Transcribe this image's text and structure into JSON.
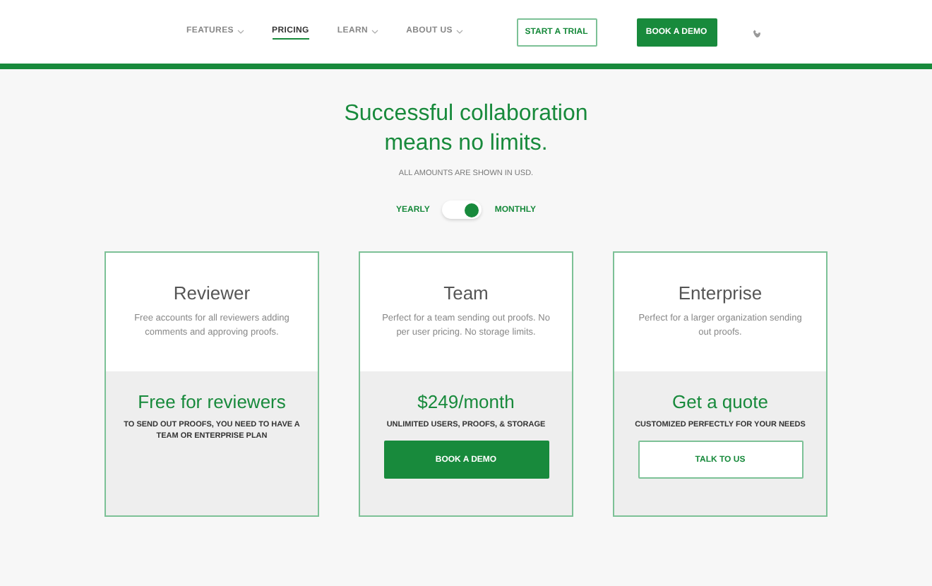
{
  "nav": {
    "items": [
      {
        "label": "FEATURES",
        "selected": false,
        "has_menu": true
      },
      {
        "label": "PRICING",
        "selected": true,
        "has_menu": false
      },
      {
        "label": "LEARN",
        "selected": false,
        "has_menu": true
      },
      {
        "label": "ABOUT US",
        "selected": false,
        "has_menu": true
      }
    ],
    "buttons": [
      {
        "label": "START A TRIAL",
        "kind": "outline"
      },
      {
        "label": "BOOK A DEMO",
        "kind": "filled"
      }
    ]
  },
  "headline": "Successful collaboration means no limits.",
  "note": "ALL AMOUNTS ARE SHOWN IN USD.",
  "billing": {
    "left": "YEARLY",
    "right": "MONTHLY",
    "on": true
  },
  "plans": [
    {
      "name": "Reviewer",
      "description": "Free accounts for all reviewers adding comments and approving proofs.",
      "price": "Free for reviewers",
      "detail": "TO SEND OUT PROOFS, YOU NEED TO HAVE A TEAM OR ENTERPRISE PLAN"
    },
    {
      "name": "Team",
      "description": "Perfect for a team sending out proofs. No per user pricing. No storage limits.",
      "price": "$249/month",
      "detail": "UNLIMITED USERS, PROOFS, & STORAGE",
      "button": {
        "label": "BOOK A DEMO",
        "kind": "filled"
      }
    },
    {
      "name": "Enterprise",
      "description": "Perfect for a larger organization sending out proofs.",
      "price": "Get a quote",
      "detail": "CUSTOMIZED PERFECTLY FOR YOUR NEEDS",
      "button": {
        "label": "TALK TO US",
        "kind": "outline"
      }
    }
  ]
}
